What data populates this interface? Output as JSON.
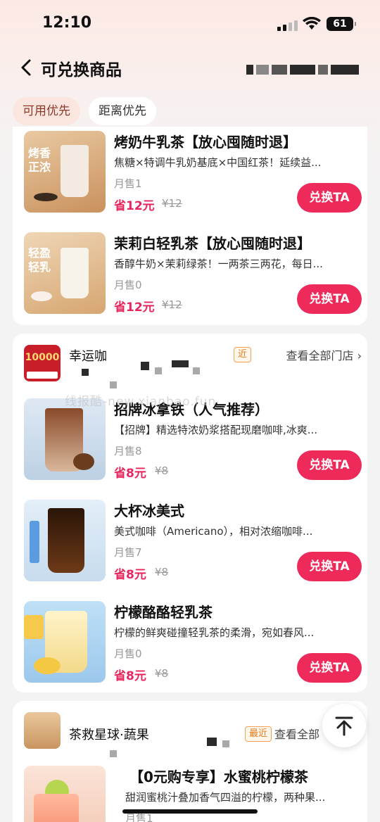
{
  "status": {
    "time": "12:10",
    "battery": "61"
  },
  "header": {
    "title": "可兑换商品"
  },
  "filters": [
    "可用优先",
    "距离优先"
  ],
  "btn_label": "兑换TA",
  "group1": {
    "items": [
      {
        "name": "烤奶牛乳茶【放心囤随时退】",
        "desc": "焦糖×特调牛乳奶基底×中国红茶！延续益...",
        "sold": "月售1",
        "save": "省12元",
        "orig": "¥12",
        "thumb_text": "烤香正浓"
      },
      {
        "name": "茉莉白轻乳茶【放心囤随时退】",
        "desc": "香醇牛奶×茉莉绿茶！一两茶三两花，每日...",
        "sold": "月售0",
        "save": "省12元",
        "orig": "¥12",
        "thumb_text": "轻盈轻乳"
      }
    ]
  },
  "group2": {
    "store_name": "幸运咖",
    "near": "近",
    "all_stores": "查看全部门店",
    "logo_text": "10000",
    "items": [
      {
        "name": "招牌冰拿铁（人气推荐）",
        "desc": "【招牌】精选特浓奶浆搭配现磨咖啡,冰爽...",
        "sold": "月售8",
        "save": "省8元",
        "orig": "¥8"
      },
      {
        "name": "大杯冰美式",
        "desc": "美式咖啡（Americano），相对浓缩咖啡...",
        "sold": "月售7",
        "save": "省8元",
        "orig": "¥8"
      },
      {
        "name": "柠檬酪酪轻乳茶",
        "desc": "柠檬的鲜爽碰撞轻乳茶的柔滑，宛如春风...",
        "sold": "月售0",
        "save": "省8元",
        "orig": "¥8"
      }
    ]
  },
  "group3": {
    "store_name": "茶救星球·蔬果",
    "near": "最近",
    "all_stores": "查看全部",
    "item": {
      "name": "【0元购专享】水蜜桃柠檬茶",
      "desc": "甜润蜜桃汁叠加香气四溢的柠檬，两种果...",
      "sold": "月售1"
    }
  },
  "watermark": "线报酷-new.xianbao.fun",
  "colors": {
    "accent": "#ee2a5a",
    "price": "#e8265e",
    "near_tag": "#e57a19"
  }
}
